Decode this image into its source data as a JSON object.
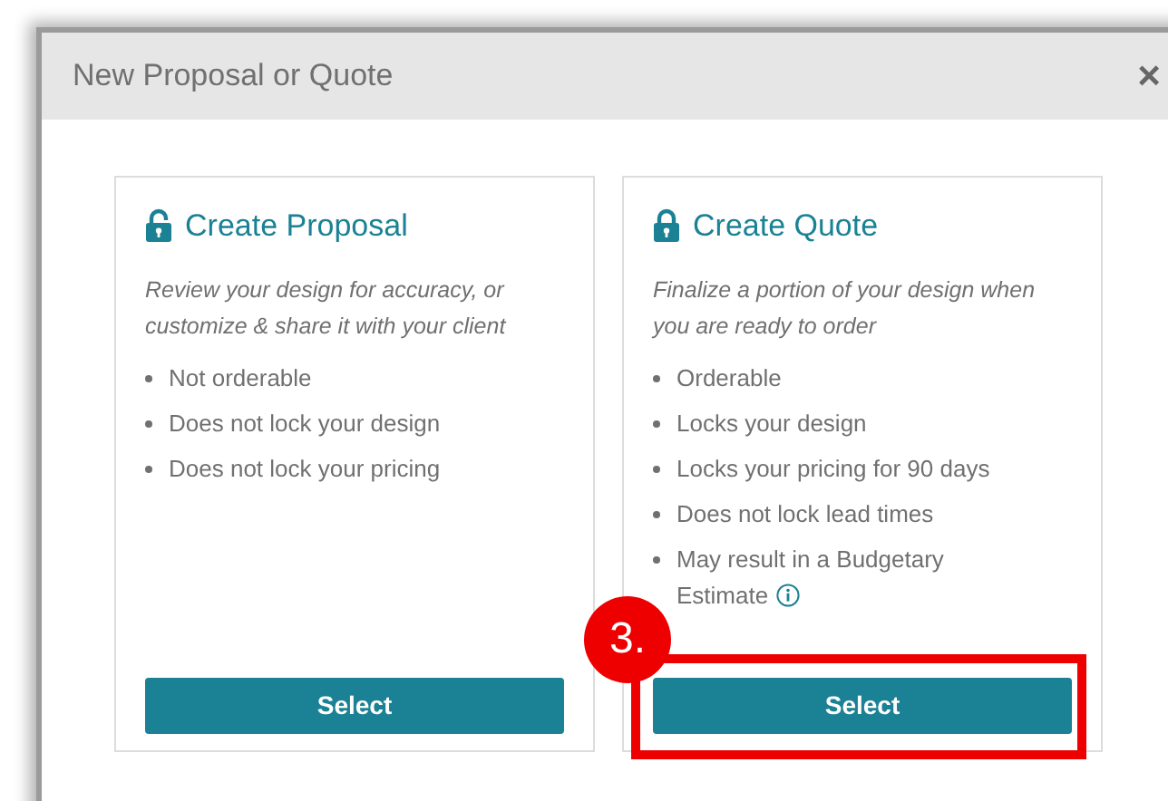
{
  "dialog": {
    "title": "New Proposal or Quote",
    "close": "×"
  },
  "cards": [
    {
      "kind": "unlocked",
      "title": "Create Proposal",
      "description": "Review your design for accuracy, or customize & share it with your client",
      "bullets": [
        {
          "text": "Not orderable",
          "info": false
        },
        {
          "text": "Does not lock your design",
          "info": false
        },
        {
          "text": "Does not lock your pricing",
          "info": false
        }
      ],
      "button": "Select",
      "highlighted": false
    },
    {
      "kind": "locked",
      "title": "Create Quote",
      "description": "Finalize a portion of your design when you are ready to order",
      "bullets": [
        {
          "text": "Orderable",
          "info": false
        },
        {
          "text": "Locks your design",
          "info": false
        },
        {
          "text": "Locks your pricing for 90 days",
          "info": false
        },
        {
          "text": "Does not lock lead times",
          "info": false
        },
        {
          "text": "May result in a Budgetary Estimate",
          "info": true
        }
      ],
      "button": "Select",
      "highlighted": true
    }
  ],
  "annotation": {
    "label": "3."
  }
}
